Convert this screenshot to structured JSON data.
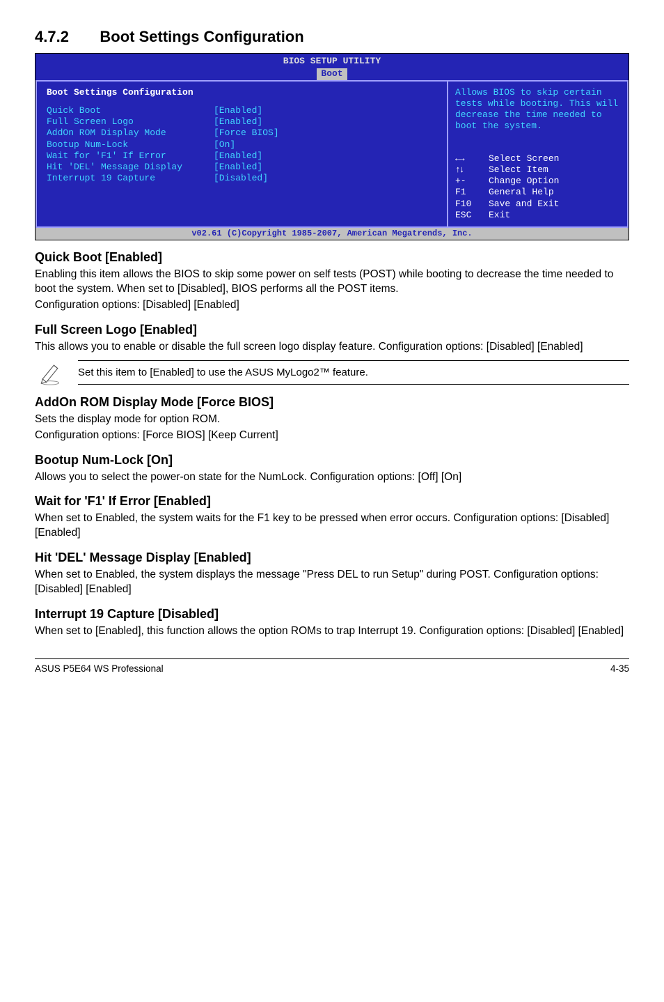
{
  "heading": {
    "number": "4.7.2",
    "title": "Boot Settings Configuration"
  },
  "bios": {
    "titlebar": "BIOS SETUP UTILITY",
    "tab": "Boot",
    "section_label": "Boot Settings Configuration",
    "rows": [
      {
        "label": "Quick Boot",
        "value": "[Enabled]"
      },
      {
        "label": "Full Screen Logo",
        "value": "[Enabled]"
      },
      {
        "label": "AddOn ROM Display Mode",
        "value": "[Force BIOS]"
      },
      {
        "label": "Bootup Num-Lock",
        "value": "[On]"
      },
      {
        "label": "Wait for 'F1' If Error",
        "value": "[Enabled]"
      },
      {
        "label": "Hit 'DEL' Message Display",
        "value": "[Enabled]"
      },
      {
        "label": "Interrupt 19 Capture",
        "value": "[Disabled]"
      }
    ],
    "help": "Allows BIOS to skip certain tests while booting. This will decrease the time needed to boot the system.",
    "keys": [
      {
        "k": "←→",
        "d": "Select Screen"
      },
      {
        "k": "↑↓",
        "d": "Select Item"
      },
      {
        "k": "+-",
        "d": "Change Option"
      },
      {
        "k": "F1",
        "d": "General Help"
      },
      {
        "k": "F10",
        "d": "Save and Exit"
      },
      {
        "k": "ESC",
        "d": "Exit"
      }
    ],
    "footer": "v02.61 (C)Copyright 1985-2007, American Megatrends, Inc."
  },
  "sections": {
    "quick_boot": {
      "h": "Quick Boot [Enabled]",
      "p1": "Enabling this item allows the BIOS to skip some power on self tests (POST) while booting to decrease the time needed to boot the system. When set to [Disabled], BIOS performs all the POST items.",
      "p2": "Configuration options: [Disabled] [Enabled]"
    },
    "full_screen": {
      "h": "Full Screen Logo [Enabled]",
      "p1": "This allows you to enable or disable the full screen logo display feature. Configuration options: [Disabled] [Enabled]"
    },
    "note": "Set this item to [Enabled] to use the ASUS MyLogo2™ feature.",
    "addon": {
      "h": "AddOn ROM Display Mode [Force BIOS]",
      "p1": "Sets the display mode for option ROM.",
      "p2": "Configuration options: [Force BIOS] [Keep Current]"
    },
    "numlock": {
      "h": "Bootup Num-Lock [On]",
      "p1": "Allows you to select the power-on state for the NumLock. Configuration options: [Off] [On]"
    },
    "waitf1": {
      "h": "Wait for 'F1' If Error [Enabled]",
      "p1": "When set to Enabled, the system waits for the F1 key to be pressed when error occurs. Configuration options: [Disabled] [Enabled]"
    },
    "hitdel": {
      "h": "Hit 'DEL' Message Display [Enabled]",
      "p1": "When set to Enabled, the system displays the message \"Press DEL to run Setup\" during POST. Configuration options: [Disabled] [Enabled]"
    },
    "int19": {
      "h": "Interrupt 19 Capture [Disabled]",
      "p1": "When set to [Enabled], this function allows the option ROMs to trap Interrupt 19. Configuration options: [Disabled] [Enabled]"
    }
  },
  "footer": {
    "left": "ASUS P5E64 WS Professional",
    "right": "4-35"
  }
}
